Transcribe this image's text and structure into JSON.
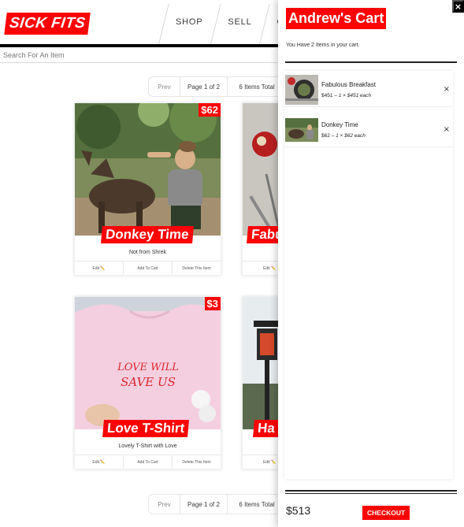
{
  "header": {
    "logo": "SICK FITS",
    "nav": [
      "SHOP",
      "SELL",
      "ORDER"
    ]
  },
  "search": {
    "placeholder": "Search For An Item"
  },
  "pagination": {
    "prev": "Prev",
    "page": "Page 1 of 2",
    "total": "6 Items Total"
  },
  "products": [
    {
      "title": "Donkey Time",
      "price": "$62",
      "description": "Not from Shrek",
      "edit": "Edit ✏️",
      "add": "Add To Cart",
      "delete": "Delete This Item"
    },
    {
      "title": "Fabu",
      "price": "",
      "description": "",
      "edit": "Edit ✏️",
      "add": "",
      "delete": ""
    },
    {
      "title": "Love T-Shirt",
      "price": "$3",
      "description": "Lovely T-Shirt with Love",
      "edit": "Edit ✏️",
      "add": "Add To Cart",
      "delete": "Delete This Item"
    },
    {
      "title": "Ha",
      "price": "",
      "description": "",
      "edit": "Edit ✏️",
      "add": "",
      "delete": ""
    }
  ],
  "tshirt_print": [
    "LOVE WILL",
    "SAVE US"
  ],
  "cart": {
    "close": "×",
    "title": "Andrew's Cart",
    "summary": "You Have 2 Items in your cart.",
    "items": [
      {
        "name": "Fabulous Breakfast",
        "total": "$451",
        "detail": "1 × $451 each",
        "remove": "×"
      },
      {
        "name": "Donkey Time",
        "total": "$62",
        "detail": "1 × $62 each",
        "remove": "×"
      }
    ],
    "grand_total": "$513",
    "checkout": "CHECKOUT"
  },
  "colors": {
    "brand_red": "#ff0000",
    "text": "#393939",
    "rule": "#000000"
  }
}
